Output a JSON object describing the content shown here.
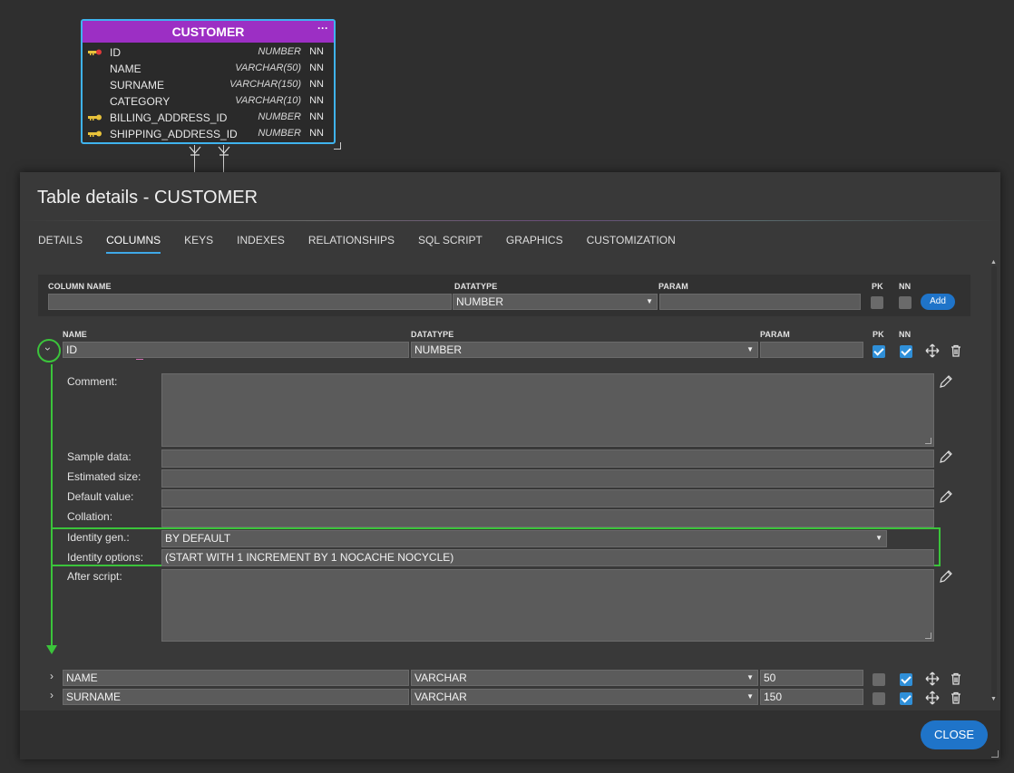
{
  "entity": {
    "title": "CUSTOMER",
    "menu": "···",
    "columns": [
      {
        "name": "ID",
        "type": "NUMBER",
        "nn": "NN",
        "key": "pk-key-icon"
      },
      {
        "name": "NAME",
        "type": "VARCHAR(50)",
        "nn": "NN",
        "key": ""
      },
      {
        "name": "SURNAME",
        "type": "VARCHAR(150)",
        "nn": "NN",
        "key": ""
      },
      {
        "name": "CATEGORY",
        "type": "VARCHAR(10)",
        "nn": "NN",
        "key": ""
      },
      {
        "name": "BILLING_ADDRESS_ID",
        "type": "NUMBER",
        "nn": "NN",
        "key": "fk-key-icon"
      },
      {
        "name": "SHIPPING_ADDRESS_ID",
        "type": "NUMBER",
        "nn": "NN",
        "key": "fk-key-icon"
      }
    ]
  },
  "dialog": {
    "title": "Table details - CUSTOMER",
    "tabs": [
      "DETAILS",
      "COLUMNS",
      "KEYS",
      "INDEXES",
      "RELATIONSHIPS",
      "SQL SCRIPT",
      "GRAPHICS",
      "CUSTOMIZATION"
    ],
    "active_tab": "COLUMNS",
    "close_label": "CLOSE"
  },
  "add_bar": {
    "column_name_header": "COLUMN NAME",
    "datatype_header": "DATATYPE",
    "param_header": "PARAM",
    "pk_header": "PK",
    "nn_header": "NN",
    "datatype_value": "NUMBER",
    "add_label": "Add"
  },
  "grid_headers": {
    "name": "NAME",
    "datatype": "DATATYPE",
    "param": "PARAM",
    "pk": "PK",
    "nn": "NN"
  },
  "columns": [
    {
      "name": "ID",
      "datatype": "NUMBER",
      "param": "",
      "pk": true,
      "nn": true,
      "expanded": true
    },
    {
      "name": "NAME",
      "datatype": "VARCHAR",
      "param": "50",
      "pk": false,
      "nn": true,
      "expanded": false
    },
    {
      "name": "SURNAME",
      "datatype": "VARCHAR",
      "param": "150",
      "pk": false,
      "nn": true,
      "expanded": false
    }
  ],
  "detail": {
    "comment_label": "Comment:",
    "sample_label": "Sample data:",
    "estimated_label": "Estimated size:",
    "default_label": "Default value:",
    "collation_label": "Collation:",
    "identity_gen_label": "Identity gen.:",
    "identity_gen_value": "BY DEFAULT",
    "identity_options_label": "Identity options:",
    "identity_options_value": "(START WITH 1 INCREMENT BY 1 NOCACHE NOCYCLE)",
    "after_script_label": "After script:"
  },
  "colors": {
    "accent": "#1f74c9",
    "entity_header": "#9c2fc4",
    "highlight": "#3bc43b",
    "entity_border": "#3fb3ee"
  }
}
